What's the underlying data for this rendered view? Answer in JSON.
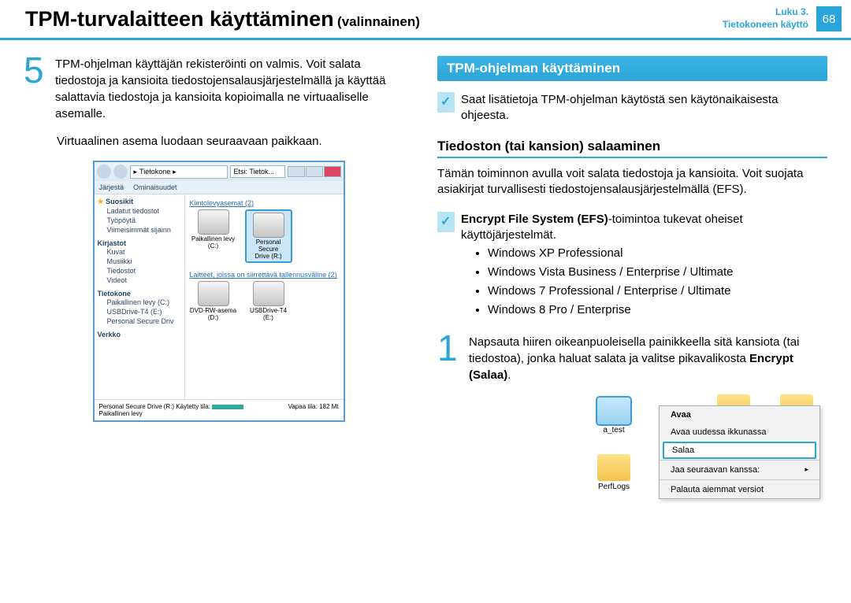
{
  "header": {
    "title": "TPM-turvalaitteen käyttäminen",
    "subtitle": "(valinnainen)",
    "chapter_line1": "Luku 3.",
    "chapter_line2": "Tietokoneen käyttö",
    "page_number": "68"
  },
  "left": {
    "step5_num": "5",
    "step5_text": "TPM-ohjelman käyttäjän rekisteröinti on valmis. Voit salata tiedostoja ja kansioita tiedostojensalausjärjestelmällä ja käyttää salattavia tiedostoja ja kansioita kopioimalla ne virtuaaliselle asemalle.",
    "after5": "Virtuaalinen asema luodaan seuraavaan paikkaan.",
    "explorer": {
      "address_segment": "Tietokone",
      "search_placeholder": "Etsi: Tietok...",
      "toolbar1": "Järjestä",
      "toolbar2": "Ominaisuudet",
      "side_fav": "Suosikit",
      "side_fav_items": [
        "Ladatut tiedostot",
        "Työpöytä",
        "Viimeisimmät sijainn"
      ],
      "side_lib": "Kirjastot",
      "side_lib_items": [
        "Kuvat",
        "Musiikki",
        "Tiedostot",
        "Videot"
      ],
      "side_comp": "Tietokone",
      "side_comp_items": [
        "Paikallinen levy (C:)",
        "USBDrive-T4 (E:)",
        "Personal Secure Driv"
      ],
      "side_net": "Verkko",
      "cat1": "Kiintolevyasemat (2)",
      "drive1": "Paikallinen levy (C:)",
      "drive2_a": "Personal Secure",
      "drive2_b": "Drive (R:)",
      "cat2": "Laitteet, joissa on siirrettävä tallennusväline (2)",
      "drive3": "DVD-RW-asema (D:)",
      "drive4": "USBDrive-T4 (E:)",
      "status_left1": "Personal Secure Drive (R:) Käytetty tila:",
      "status_left2": "Paikallinen levy",
      "status_right": "Vapaa tila: 182 Mt"
    }
  },
  "right": {
    "section_title": "TPM-ohjelman käyttäminen",
    "note1": "Saat lisätietoja TPM-ohjelman käytöstä sen käytönaikaisesta ohjeesta.",
    "sub_heading": "Tiedoston (tai kansion) salaaminen",
    "para1": "Tämän toiminnon avulla voit salata tiedostoja ja kansioita. Voit suojata asiakirjat turvallisesti tiedostojensalausjärjestelmällä (EFS).",
    "efs_bold": "Encrypt File System (EFS)",
    "efs_rest": "-toimintoa tukevat oheiset käyttöjärjestelmät.",
    "os_list": [
      "Windows XP Professional",
      "Windows Vista Business / Enterprise / Ultimate",
      "Windows 7 Professional / Enterprise / Ultimate",
      "Windows 8 Pro / Enterprise"
    ],
    "step1_num": "1",
    "step1_text_a": "Napsauta hiiren oikeanpuoleisella painikkeella sitä kansiota (tai tiedostoa), jonka haluat salata ja valitse pikavalikosta ",
    "step1_bold": "Encrypt (Salaa)",
    "context": {
      "folder_sel": "a_test",
      "folder_other": "PerfLogs",
      "menu": {
        "open": "Avaa",
        "open_new": "Avaa uudessa ikkunassa",
        "encrypt": "Salaa",
        "share": "Jaa seuraavan kanssa:",
        "restore": "Palauta aiemmat versiot"
      }
    }
  }
}
